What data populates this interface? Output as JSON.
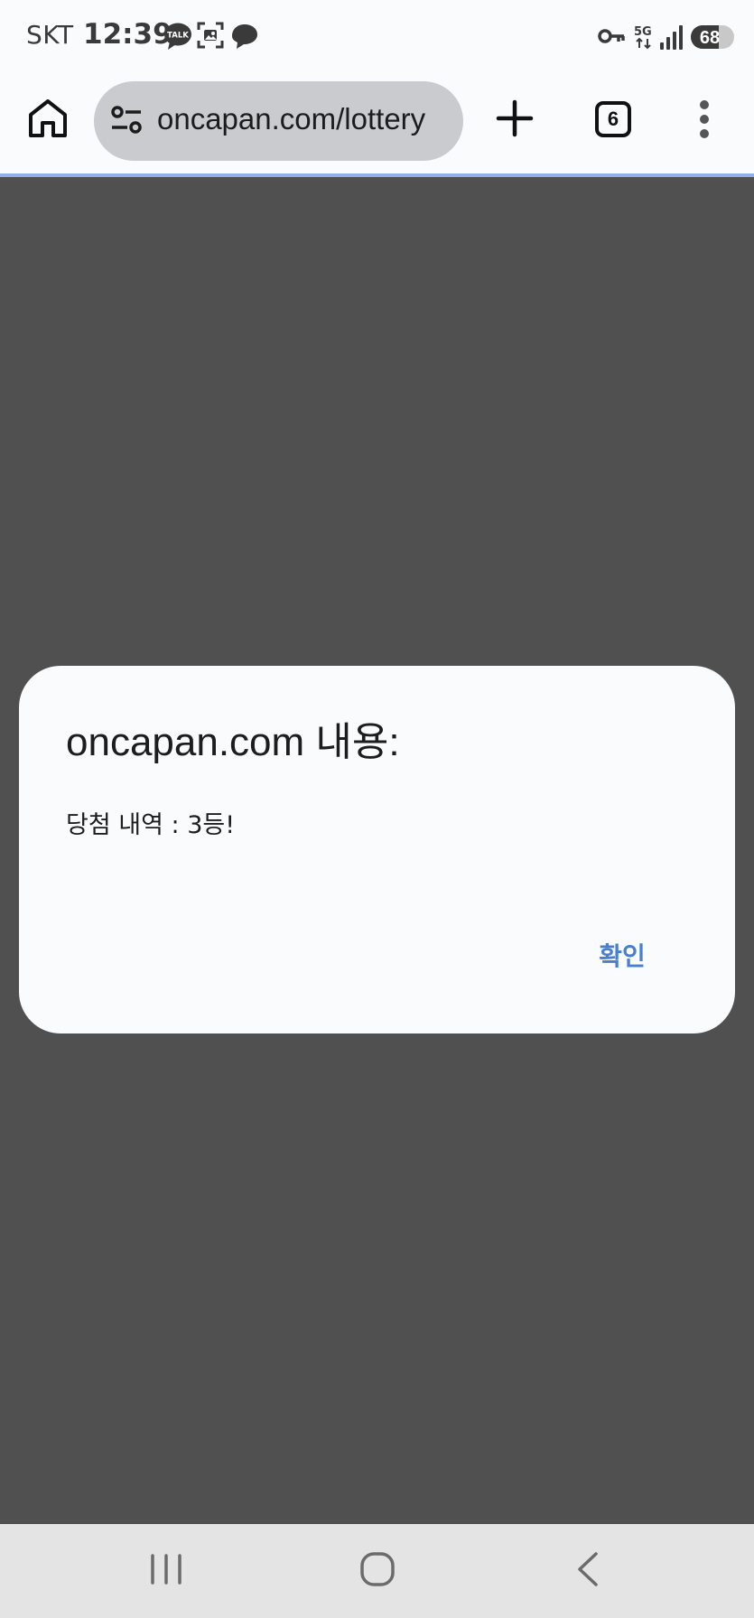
{
  "status_bar": {
    "carrier": "SKT",
    "time": "12:39",
    "network": "5G",
    "battery": "68",
    "icons": [
      "kakaotalk-icon",
      "screenshot-icon",
      "chat-icon",
      "key-icon",
      "signal-icon",
      "battery-icon"
    ]
  },
  "toolbar": {
    "url": "oncapan.com/lottery",
    "tab_count": "6",
    "icons": [
      "home-icon",
      "site-settings-icon",
      "plus-icon",
      "tab-switcher-icon",
      "more-vert-icon"
    ]
  },
  "dialog": {
    "title": "oncapan.com 내용:",
    "message": "당첨 내역 : 3등!",
    "ok_label": "확인",
    "accent_color": "#4a7fd0"
  },
  "nav_bar": {
    "icons": [
      "recent-apps-icon",
      "home-circle-icon",
      "back-icon"
    ]
  },
  "colors": {
    "overlay": "#505050",
    "chrome": "#fafbfd",
    "url_pill": "#cacbcf",
    "progress_line": "#8fb0e8",
    "nav_bar": "#e4e4e4"
  }
}
